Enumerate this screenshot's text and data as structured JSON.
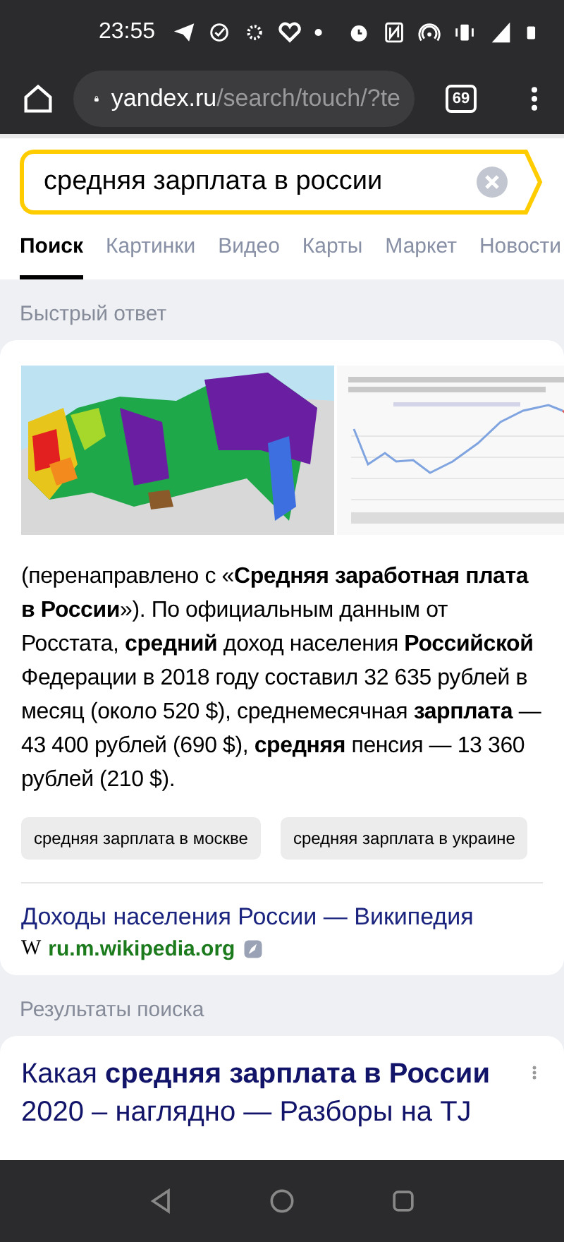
{
  "status_bar": {
    "time": "23:55"
  },
  "browser": {
    "url_host": "yandex.ru",
    "url_path": "/search/touch/?te",
    "tab_count": "69"
  },
  "search": {
    "value": "средняя зарплата в россии"
  },
  "tabs": [
    {
      "label": "Поиск",
      "selected": true
    },
    {
      "label": "Картинки",
      "selected": false
    },
    {
      "label": "Видео",
      "selected": false
    },
    {
      "label": "Карты",
      "selected": false
    },
    {
      "label": "Маркет",
      "selected": false
    },
    {
      "label": "Новости",
      "selected": false
    }
  ],
  "quick_answer": {
    "heading": "Быстрый ответ",
    "text": "(перенаправлено с «**Средняя заработная плата в России**»). По официальным данным от Росстата, **средний** доход населения **Российской** Федерации в 2018 году составил 32 635 рублей в месяц (около 520 $), среднемесячная **зарплата** — 43 400 рублей (690 $), **средняя** пенсия — 13 360 рублей (210 $).",
    "suggestions": [
      "средняя зарплата в москве",
      "средняя зарплата в украине"
    ],
    "source_title": "Доходы населения России — Википедия",
    "source_icon": "W",
    "source_url": "ru.m.wikipedia.org"
  },
  "results": {
    "heading": "Результаты поиска",
    "items": [
      {
        "title": "Какая **средняя зарплата в России** 2020 – наглядно — Разборы на TJ"
      }
    ]
  }
}
